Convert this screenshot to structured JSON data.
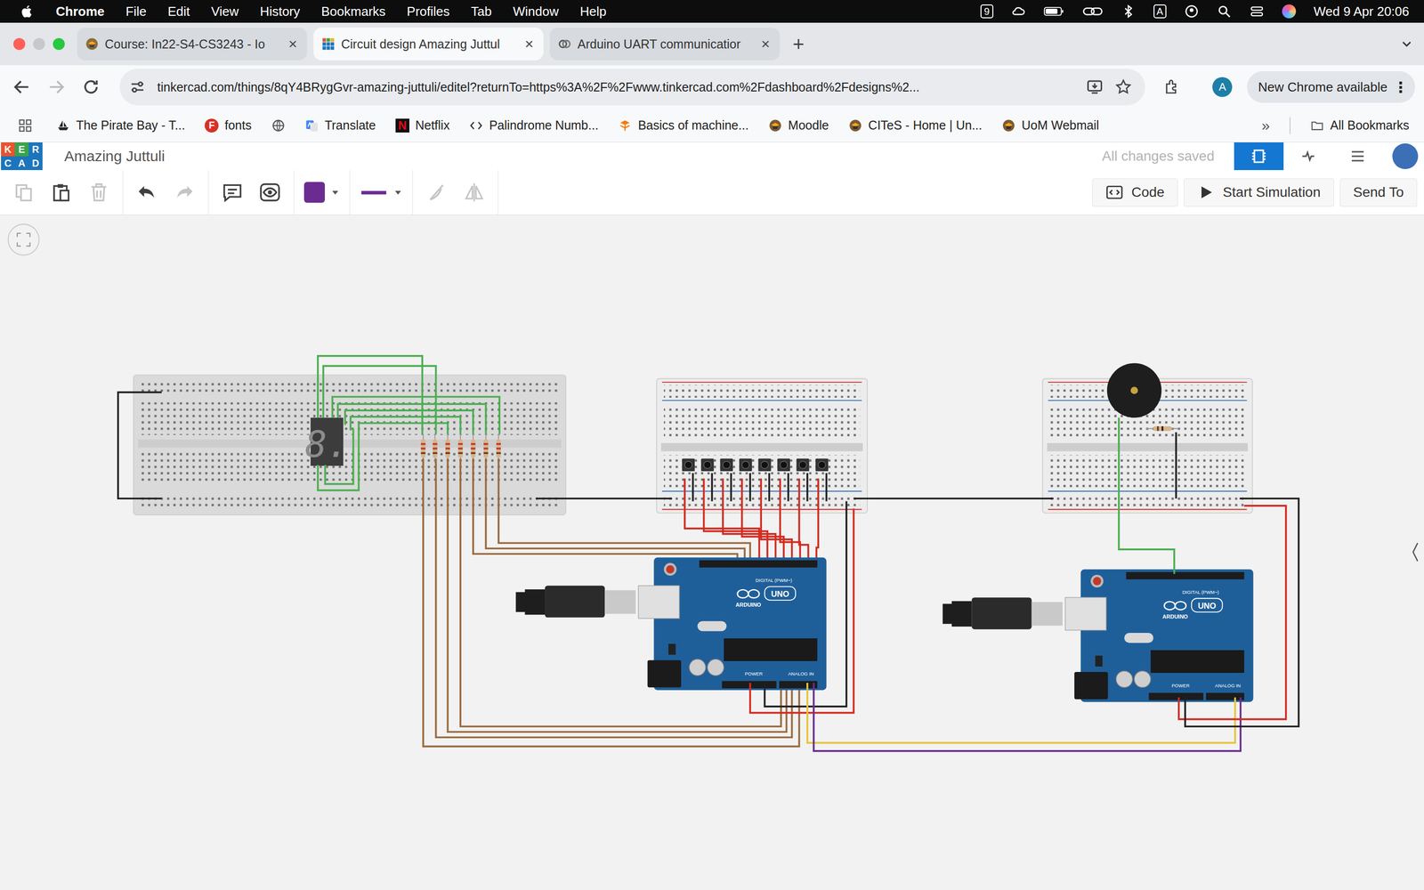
{
  "menu_bar": {
    "app": "Chrome",
    "items": [
      "File",
      "Edit",
      "View",
      "History",
      "Bookmarks",
      "Profiles",
      "Tab",
      "Window",
      "Help"
    ],
    "calendar_badge": "9",
    "input_source": "A",
    "clock": "Wed 9 Apr  20:06"
  },
  "browser": {
    "tabs": [
      {
        "label": "Course: In22-S4-CS3243 - Io",
        "selected": false,
        "kind": "moodle",
        "close": "×"
      },
      {
        "label": "Circuit design Amazing Juttul",
        "selected": true,
        "kind": "tinkercad",
        "close": "×"
      },
      {
        "label": "Arduino UART communicatior",
        "selected": false,
        "kind": "chat",
        "close": "×"
      }
    ],
    "new_tab": "+",
    "url": "tinkercad.com/things/8qY4BRygGvr-amazing-juttuli/editel?returnTo=https%3A%2F%2Fwww.tinkercad.com%2Fdashboard%2Fdesigns%2...",
    "profile": "A",
    "update": "New Chrome available",
    "more": "⋮",
    "bookmarks": [
      {
        "label": "The Pirate Bay - T...",
        "kind": "ship",
        "badge": ""
      },
      {
        "label": "fonts",
        "kind": "badge-circle",
        "badge": "F"
      },
      {
        "label": "",
        "kind": "globe",
        "badge": ""
      },
      {
        "label": "Translate",
        "kind": "translate",
        "badge": ""
      },
      {
        "label": "Netflix",
        "kind": "netflix",
        "badge": "N"
      },
      {
        "label": "Palindrome Numb...",
        "kind": "code",
        "badge": ""
      },
      {
        "label": "Basics of machine...",
        "kind": "fire",
        "badge": ""
      },
      {
        "label": "Moodle",
        "kind": "moodle",
        "badge": ""
      },
      {
        "label": "CITeS - Home | Un...",
        "kind": "moodle",
        "badge": ""
      },
      {
        "label": "UoM Webmail",
        "kind": "moodle",
        "badge": ""
      }
    ],
    "bookmarks_overflow": "»",
    "all_bookmarks": "All Bookmarks"
  },
  "tinkercad": {
    "logo": [
      "K",
      "E",
      "R",
      "C",
      "A",
      "D"
    ],
    "title": "Amazing Juttuli",
    "save_status": "All changes saved"
  },
  "toolbar": {
    "tools": [
      {
        "kind": "copy",
        "disabled": true
      },
      {
        "kind": "paste",
        "disabled": false
      },
      {
        "kind": "delete",
        "disabled": true
      },
      {
        "kind": "undo",
        "disabled": false
      },
      {
        "kind": "redo",
        "disabled": true
      },
      {
        "kind": "note",
        "disabled": false
      },
      {
        "kind": "eye",
        "disabled": false
      },
      {
        "kind": "swatch",
        "disabled": false
      },
      {
        "kind": "line",
        "disabled": false
      },
      {
        "kind": "rotate",
        "disabled": true
      },
      {
        "kind": "flip",
        "disabled": true
      }
    ],
    "wire_color": "#6b2c91",
    "code": "Code",
    "simulate": "Start Simulation",
    "send": "Send To"
  },
  "circuit": {
    "display": "8.",
    "boards": [
      {
        "brand": "ARDUINO",
        "model": "UNO",
        "digital": "DIGITAL (PWM~)",
        "power": "POWER",
        "analog": "ANALOG IN"
      },
      {
        "brand": "ARDUINO",
        "model": "UNO",
        "digital": "DIGITAL (PWM~)",
        "power": "POWER",
        "analog": "ANALOG IN"
      }
    ]
  }
}
